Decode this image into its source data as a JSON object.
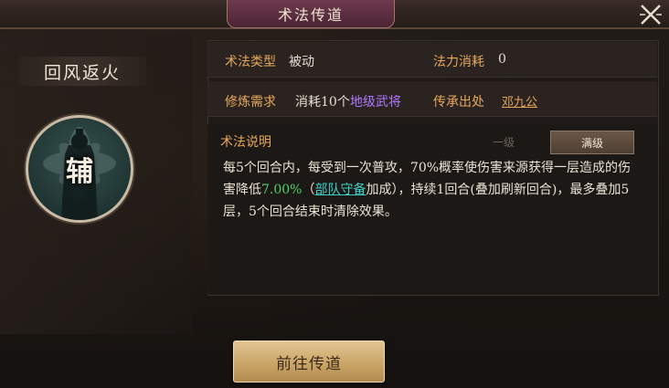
{
  "window": {
    "title": "术法传道"
  },
  "skill": {
    "name": "回风返火",
    "role_char": "辅"
  },
  "info": {
    "type_label": "术法类型",
    "type_value": "被动",
    "cost_label": "法力消耗",
    "cost_value": "0",
    "req_label": "修炼需求",
    "req_prefix": "消耗10个",
    "req_highlight": "地级武将",
    "source_label": "传承出处",
    "source_value": "邓九公"
  },
  "description": {
    "label": "术法说明",
    "tabs": [
      "一级",
      "满级"
    ],
    "selected_tab": "满级",
    "text_1": "每5个回合内，每受到一次普攻，70%概率使伤害来源获得一层造成的伤害降低",
    "percent": "7.00%",
    "text_2": "（",
    "link": "部队守备",
    "text_3": "加成），持续1回合(叠加刷新回合)，最多叠加5层，5个回合结束时清除效果。"
  },
  "buttons": {
    "go": "前往传道"
  },
  "colors": {
    "accent_orange": "#e6a85c",
    "purple": "#b07aff",
    "green": "#4fd26a",
    "cyan": "#3fd0c8"
  },
  "icons": {
    "close": "close-x-icon",
    "portrait": "portrait-icon"
  }
}
